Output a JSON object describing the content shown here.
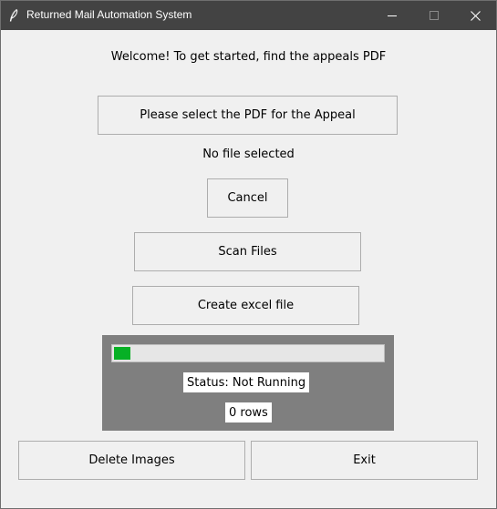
{
  "window": {
    "title": "Returned Mail Automation System",
    "icon": "feather-icon",
    "controls": [
      "minimize-icon",
      "maximize-icon",
      "close-icon"
    ]
  },
  "main": {
    "welcome_text": "Welcome! To get started, find the appeals PDF",
    "select_pdf_label": "Please select the PDF for the Appeal",
    "file_status": "No file selected",
    "cancel_label": "Cancel",
    "scan_label": "Scan Files",
    "create_excel_label": "Create excel file"
  },
  "progress": {
    "fraction": 0.06,
    "fill_color": "#06b025",
    "status_text": "Status: Not Running",
    "rows_text": "0 rows"
  },
  "footer": {
    "delete_label": "Delete Images",
    "exit_label": "Exit"
  }
}
